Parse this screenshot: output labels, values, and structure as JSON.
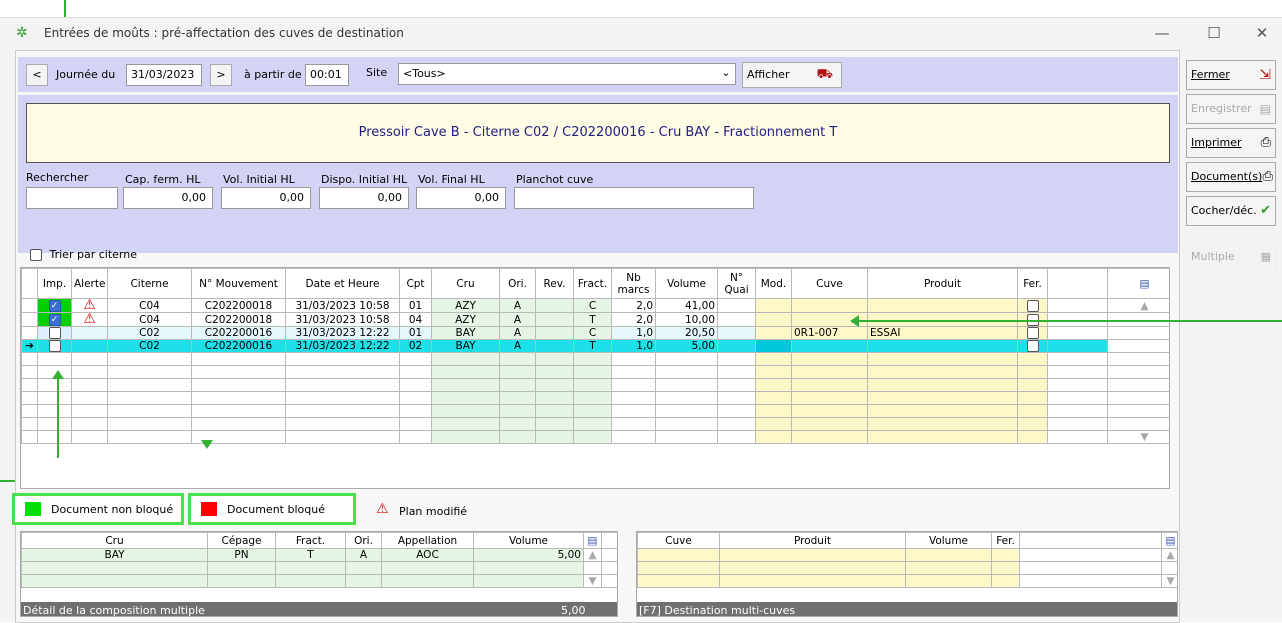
{
  "window": {
    "title": "Entrées de moûts : pré-affectation des cuves de destination"
  },
  "toolbar": {
    "prev": "<",
    "next": ">",
    "journee_label": "Journée du",
    "date": "31/03/2023",
    "apartir_label": "à partir de",
    "time": "00:01",
    "site_label": "Site",
    "site_value": "<Tous>",
    "afficher": "Afficher"
  },
  "banner": {
    "text": "Pressoir Cave B - Citerne C02 /  C202200016 - Cru BAY - Fractionnement T"
  },
  "fields": {
    "rechercher": "Rechercher",
    "cap_label": "Cap. ferm. HL",
    "cap_value": "0,00",
    "volinit_label": "Vol. Initial HL",
    "volinit_value": "0,00",
    "dispo_label": "Dispo. Initial HL",
    "dispo_value": "0,00",
    "volfinal_label": "Vol. Final HL",
    "volfinal_value": "0,00",
    "planchot_label": "Planchot cuve",
    "planchot_value": ""
  },
  "trier": "Trier par citerne",
  "main_table": {
    "headers": [
      "Imp.",
      "Alerte",
      "Citerne",
      "N° Mouvement",
      "Date et Heure",
      "Cpt",
      "Cru",
      "Ori.",
      "Rev.",
      "Fract.",
      "Nb marcs",
      "Volume",
      "N° Quai",
      "Mod.",
      "Cuve",
      "Produit",
      "Fer."
    ],
    "rows": [
      {
        "imp": true,
        "alerte": true,
        "citerne": "C04",
        "mouvement": "C202200018",
        "date": "31/03/2023  10:58",
        "cpt": "01",
        "cru": "AZY",
        "ori": "A",
        "rev": "",
        "fract": "C",
        "nb": "2,0",
        "volume": "41,00",
        "quai": "",
        "mod": "",
        "cuve": "",
        "produit": "",
        "fer": false
      },
      {
        "imp": true,
        "alerte": true,
        "citerne": "C04",
        "mouvement": "C202200018",
        "date": "31/03/2023  10:58",
        "cpt": "04",
        "cru": "AZY",
        "ori": "A",
        "rev": "",
        "fract": "T",
        "nb": "2,0",
        "volume": "10,00",
        "quai": "",
        "mod": "",
        "cuve": "",
        "produit": "",
        "fer": false
      },
      {
        "imp": false,
        "alerte": false,
        "citerne": "C02",
        "mouvement": "C202200016",
        "date": "31/03/2023  12:22",
        "cpt": "01",
        "cru": "BAY",
        "ori": "A",
        "rev": "",
        "fract": "C",
        "nb": "1,0",
        "volume": "20,50",
        "quai": "",
        "mod": "",
        "cuve": "0R1-007",
        "produit": "ESSAI",
        "fer": false
      },
      {
        "imp": false,
        "alerte": false,
        "citerne": "C02",
        "mouvement": "C202200016",
        "date": "31/03/2023  12:22",
        "cpt": "02",
        "cru": "BAY",
        "ori": "A",
        "rev": "",
        "fract": "T",
        "nb": "1,0",
        "volume": "5,00",
        "quai": "",
        "mod": "",
        "cuve": "",
        "produit": "",
        "fer": false
      }
    ]
  },
  "legend": {
    "non_bloque": "Document non bloqué",
    "bloque": "Document bloqué",
    "plan_modifie": "Plan modifié",
    "green": "#00e000",
    "red": "#ff0000"
  },
  "comp_table": {
    "headers": [
      "Cru",
      "Cépage",
      "Fract.",
      "Ori.",
      "Appellation",
      "Volume"
    ],
    "rows": [
      [
        "BAY",
        "PN",
        "T",
        "A",
        "AOC",
        "5,00"
      ]
    ],
    "footer_label": "Détail de la composition multiple",
    "footer_total": "5,00"
  },
  "dest_table": {
    "headers": [
      "Cuve",
      "Produit",
      "Volume",
      "Fer."
    ],
    "footer_label": "[F7] Destination multi-cuves"
  },
  "side": {
    "fermer": "Fermer",
    "enregistrer": "Enregistrer",
    "imprimer": "Imprimer",
    "documents": "Document(s)",
    "cocher": "Cocher/déc.",
    "multiple": "Multiple"
  }
}
